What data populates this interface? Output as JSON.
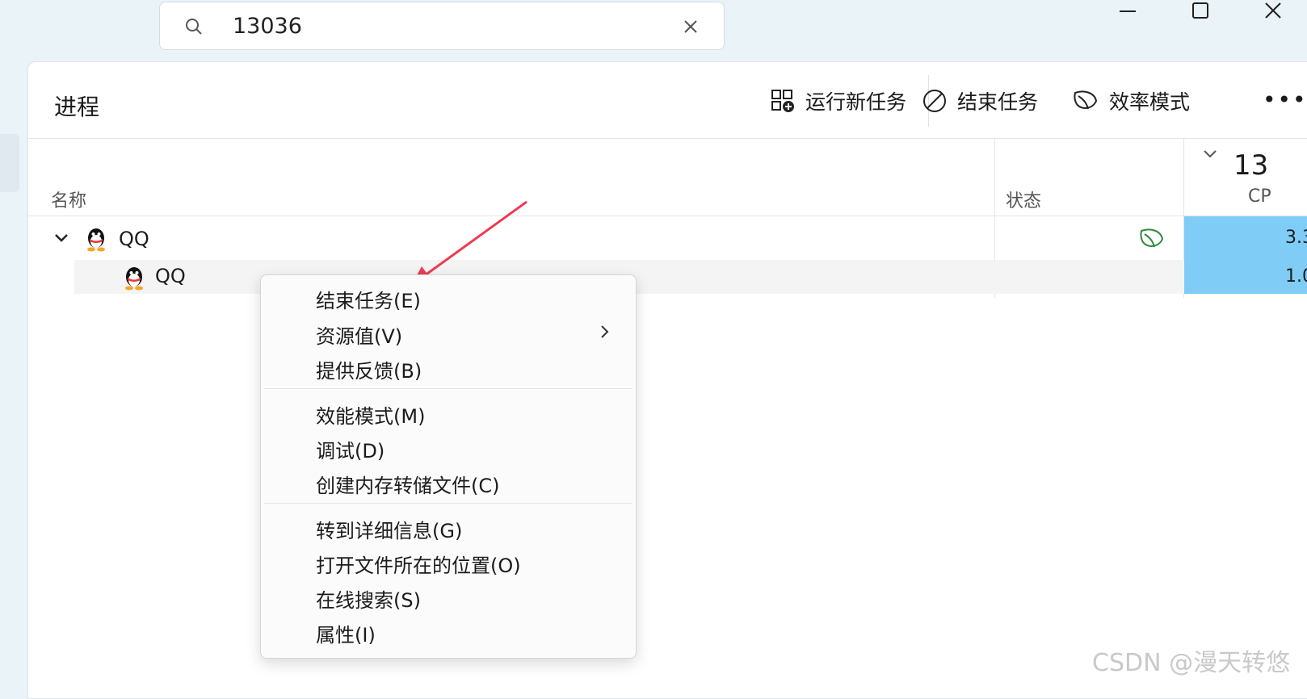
{
  "search": {
    "value": "13036"
  },
  "page_title": "进程",
  "toolbar": {
    "run_new_task": "运行新任务",
    "end_task": "结束任务",
    "efficiency_mode": "效率模式",
    "more": "•••"
  },
  "header": {
    "cpu_percent": "13",
    "name_label": "名称",
    "status_label": "状态",
    "cpu_label": "CP"
  },
  "rows": [
    {
      "name": "QQ",
      "cpu": "3.3"
    },
    {
      "name": "QQ",
      "cpu": "1.0"
    }
  ],
  "context_menu": {
    "items": [
      "结束任务(E)",
      "资源值(V)",
      "提供反馈(B)",
      "效能模式(M)",
      "调试(D)",
      "创建内存转储文件(C)",
      "转到详细信息(G)",
      "打开文件所在的位置(O)",
      "在线搜索(S)",
      "属性(I)"
    ]
  },
  "watermark": "CSDN @漫天转悠",
  "colors": {
    "accent_cpu": "#7fcdf6",
    "leaf": "#2e8b3c",
    "arrow": "#ee3b50"
  }
}
